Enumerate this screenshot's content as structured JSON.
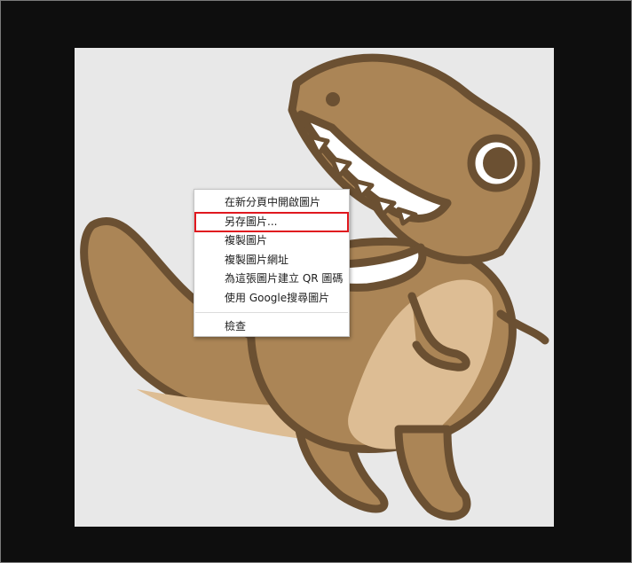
{
  "context_menu": {
    "items": [
      {
        "label": "在新分頁中開啟圖片"
      },
      {
        "label": "另存圖片..."
      },
      {
        "label": "複製圖片"
      },
      {
        "label": "複製圖片網址"
      },
      {
        "label": "為這張圖片建立 QR 圖碼"
      },
      {
        "label": "使用 Google搜尋圖片"
      },
      {
        "label": "檢查"
      }
    ],
    "highlighted_index": 1
  },
  "image": {
    "subject": "cartoon brown dinosaur",
    "colors": {
      "body": "#ab8556",
      "belly": "#ddbd94",
      "outline": "#6b5032",
      "background": "#e8e8e8",
      "frame": "#0e0e0e",
      "highlight_border": "#e0181f"
    }
  }
}
